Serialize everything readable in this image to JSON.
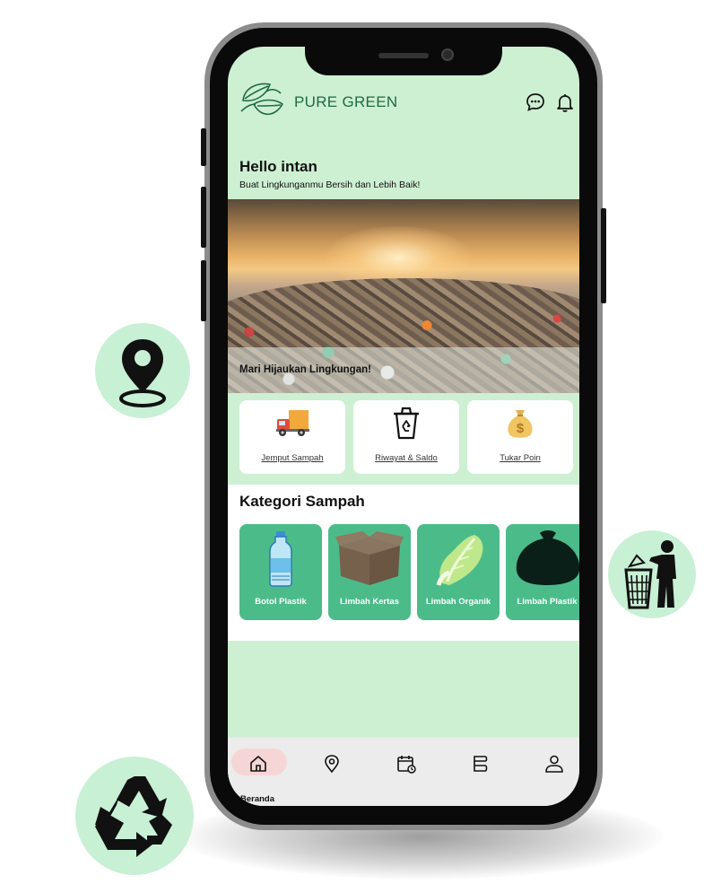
{
  "app": {
    "brand_name": "PURE GREEN",
    "accent_color": "#4cbb8a",
    "background_color": "#cdf0d2"
  },
  "header": {
    "icons": [
      "chat-icon",
      "bell-icon"
    ]
  },
  "greeting": {
    "title": "Hello intan",
    "subtitle": "Buat Lingkunganmu Bersih dan Lebih Baik!"
  },
  "banner": {
    "caption": "Mari Hijaukan Lingkungan!"
  },
  "quick_menu": [
    {
      "label": "Jemput Sampah",
      "icon": "truck-icon"
    },
    {
      "label": "Riwayat & Saldo",
      "icon": "recycle-bin-icon"
    },
    {
      "label": "Tukar Poin",
      "icon": "money-bag-icon"
    }
  ],
  "categories": {
    "title": "Kategori Sampah",
    "items": [
      {
        "label": "Botol Plastik",
        "icon": "plastic-bottle-icon"
      },
      {
        "label": "Limbah Kertas",
        "icon": "cardboard-box-icon"
      },
      {
        "label": "Limbah Organik",
        "icon": "cabbage-icon"
      },
      {
        "label": "Limbah Plastik",
        "icon": "trash-bag-icon"
      }
    ]
  },
  "bottom_nav": {
    "active": "Beranda",
    "items": [
      {
        "label": "Beranda",
        "icon": "home-icon"
      },
      {
        "label": "",
        "icon": "location-icon"
      },
      {
        "label": "",
        "icon": "calendar-icon"
      },
      {
        "label": "",
        "icon": "stack-icon"
      },
      {
        "label": "",
        "icon": "profile-icon"
      }
    ]
  },
  "decorations": [
    "map-pin-icon",
    "trash-disposal-icon",
    "recycle-icon"
  ]
}
